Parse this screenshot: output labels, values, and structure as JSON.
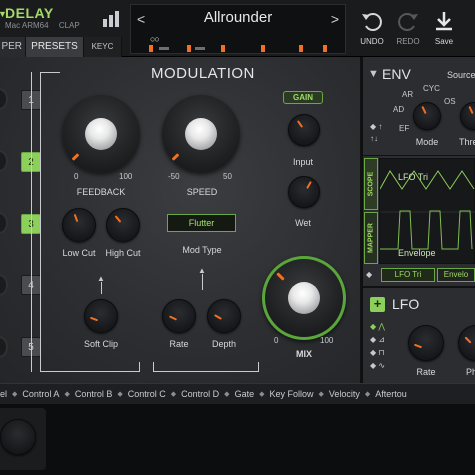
{
  "app": {
    "title": "DELAY",
    "platform": "Mac ARM64",
    "format": "CLAP"
  },
  "tabs": [
    {
      "label": "PER"
    },
    {
      "label": "PRESETS"
    },
    {
      "label": "KEYC"
    }
  ],
  "preset": {
    "name": "Allrounder",
    "prev": "<",
    "next": ">",
    "bubbles": "○○"
  },
  "toolbar": {
    "undo": "UNDO",
    "redo": "REDO",
    "save": "Save"
  },
  "modulation": {
    "title": "MODULATION",
    "gain_label": "GAIN",
    "feedback": {
      "label": "FEEDBACK",
      "min": "0",
      "max": "100"
    },
    "speed": {
      "label": "SPEED",
      "min": "-50",
      "max": "50"
    },
    "input_label": "Input",
    "wet_label": "Wet",
    "low_cut_label": "Low Cut",
    "high_cut_label": "High Cut",
    "mod_type": {
      "value": "Flutter",
      "label": "Mod Type"
    },
    "soft_clip_label": "Soft Clip",
    "rate_label": "Rate",
    "depth_label": "Depth",
    "mix": {
      "label": "MIX",
      "min": "0",
      "max": "100"
    },
    "slots": [
      "1",
      "2",
      "3",
      "4",
      "5"
    ],
    "active_slots": [
      "2",
      "3"
    ]
  },
  "env": {
    "title": "ENV",
    "source_label": "Source",
    "stages": [
      "AR",
      "CYC",
      "AD",
      "OS",
      "EF"
    ],
    "mode_label": "Mode",
    "thresh_label": "Thre",
    "arrows": "↑↓"
  },
  "scope": {
    "tabs": [
      "SCOPE",
      "MAPPER"
    ],
    "lfo_trace_label": "LFO Tri",
    "envelope_trace_label": "Envelope",
    "chips": [
      "LFO Tri",
      "Envelo"
    ]
  },
  "lfo": {
    "title": "LFO",
    "plus": "+",
    "rate_label": "Rate",
    "phase_label": "Ph"
  },
  "mod_sources": [
    "el",
    "Control A",
    "Control B",
    "Control C",
    "Control D",
    "Gate",
    "Key Follow",
    "Velocity",
    "Aftertou"
  ],
  "colors": {
    "accent_green": "#8ccf5a",
    "accent_orange": "#f36f21"
  }
}
